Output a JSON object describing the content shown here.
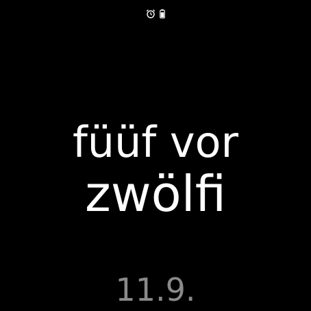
{
  "status_bar": {
    "icons": [
      "alarm-clock-icon",
      "battery-icon"
    ]
  },
  "watch_face": {
    "time_line_1": "füüf vor",
    "time_line_2": "zwölfi",
    "date": "11.9."
  },
  "colors": {
    "background": "#000000",
    "time_text": "#ffffff",
    "date_text": "#8a8a8a",
    "status_icons": "#ffffff"
  }
}
